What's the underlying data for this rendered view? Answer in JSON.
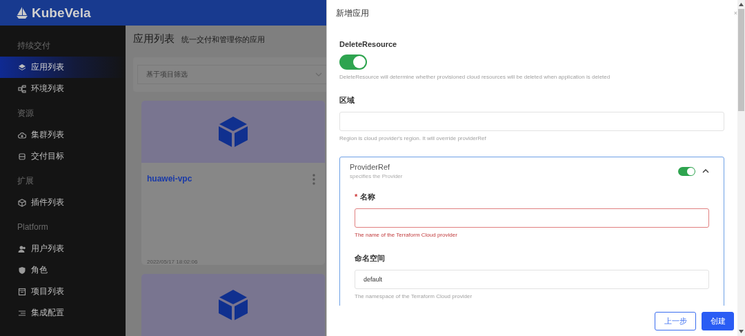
{
  "header": {
    "logo_text": "KubeVela"
  },
  "sidebar": {
    "sections": [
      {
        "title": "持续交付",
        "items": [
          {
            "label": "应用列表",
            "selected": true
          },
          {
            "label": "环境列表",
            "selected": false
          }
        ]
      },
      {
        "title": "资源",
        "items": [
          {
            "label": "集群列表",
            "selected": false
          },
          {
            "label": "交付目标",
            "selected": false
          }
        ]
      },
      {
        "title": "扩展",
        "items": [
          {
            "label": "插件列表",
            "selected": false
          }
        ]
      },
      {
        "title": "Platform",
        "items": [
          {
            "label": "用户列表",
            "selected": false
          },
          {
            "label": "角色",
            "selected": false
          },
          {
            "label": "项目列表",
            "selected": false
          },
          {
            "label": "集成配置",
            "selected": false
          }
        ]
      }
    ]
  },
  "page": {
    "title": "应用列表",
    "subtitle": "统一交付和管理你的应用",
    "filter": {
      "placeholder": "基于项目筛选"
    },
    "cards": [
      {
        "kind": "full",
        "name": "huawei-vpc",
        "time": "2022/05/17 18:02:06"
      },
      {
        "kind": "cut"
      }
    ]
  },
  "drawer": {
    "title": "新增应用",
    "close": "×",
    "fields": [
      {
        "kind": "switch",
        "label": "DeleteResource",
        "on": true,
        "help": "DeleteResource will determine whether provisioned cloud resources will be deleted when application is deleted"
      },
      {
        "kind": "input",
        "label": "区域",
        "help": "Region is cloud provider's region. It will override providerRef"
      },
      {
        "kind": "group",
        "title": "ProviderRef",
        "subtitle": "specifies the Provider",
        "on": true,
        "expanded": true,
        "fields": [
          {
            "kind": "input",
            "label": "名称",
            "required_mark": "*",
            "error": true,
            "help": "The name of the Terraform Cloud provider"
          },
          {
            "kind": "input",
            "label": "命名空间",
            "value": "default",
            "error": false,
            "help": "The namespace of the Terraform Cloud provider"
          }
        ]
      }
    ],
    "buttons": [
      {
        "label": "上一步",
        "primary": false
      },
      {
        "label": "创建",
        "primary": true
      }
    ]
  }
}
